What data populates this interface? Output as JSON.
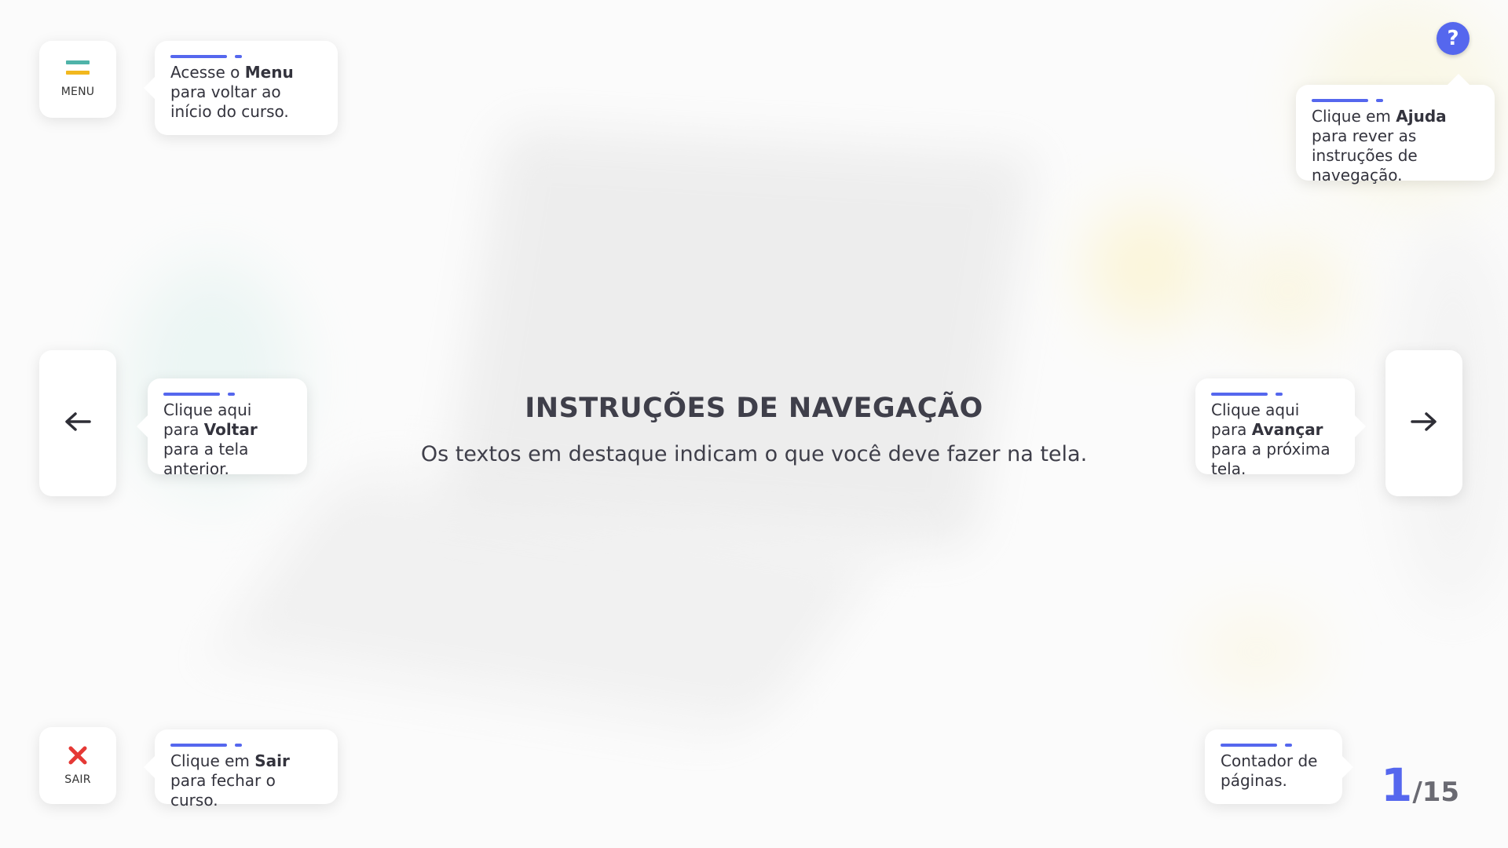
{
  "colors": {
    "accent": "#5567ee",
    "menu_teal": "#4fb3a9",
    "menu_yellow": "#f2b81e",
    "exit_red": "#e53935",
    "text": "#33333d"
  },
  "main": {
    "title": "INSTRUÇÕES DE NAVEGAÇÃO",
    "subtitle": "Os textos em destaque indicam o que você deve fazer na tela."
  },
  "menu_button": {
    "label": "MENU",
    "icon": "menu-icon"
  },
  "exit_button": {
    "label": "SAIR",
    "icon": "close-icon"
  },
  "back_button": {
    "icon": "arrow-left-icon"
  },
  "next_button": {
    "icon": "arrow-right-icon"
  },
  "help_button": {
    "label": "?",
    "icon": "help-icon"
  },
  "tips": {
    "menu": {
      "pre": "Acesse o ",
      "bold": "Menu",
      "post": " para voltar ao início do curso."
    },
    "help": {
      "pre": "Clique em ",
      "bold": "Ajuda",
      "post": " para rever as instruções de navegação."
    },
    "back": {
      "pre": "Clique aqui para ",
      "bold": "Voltar",
      "post": " para a tela anterior."
    },
    "next": {
      "pre": "Clique aqui para ",
      "bold": "Avançar",
      "post": " para a próxima tela."
    },
    "exit": {
      "pre": "Clique em ",
      "bold": "Sair",
      "post": " para fechar o curso."
    },
    "counter": {
      "text": "Contador de páginas."
    }
  },
  "page_counter": {
    "current": "1",
    "total": "/15"
  }
}
